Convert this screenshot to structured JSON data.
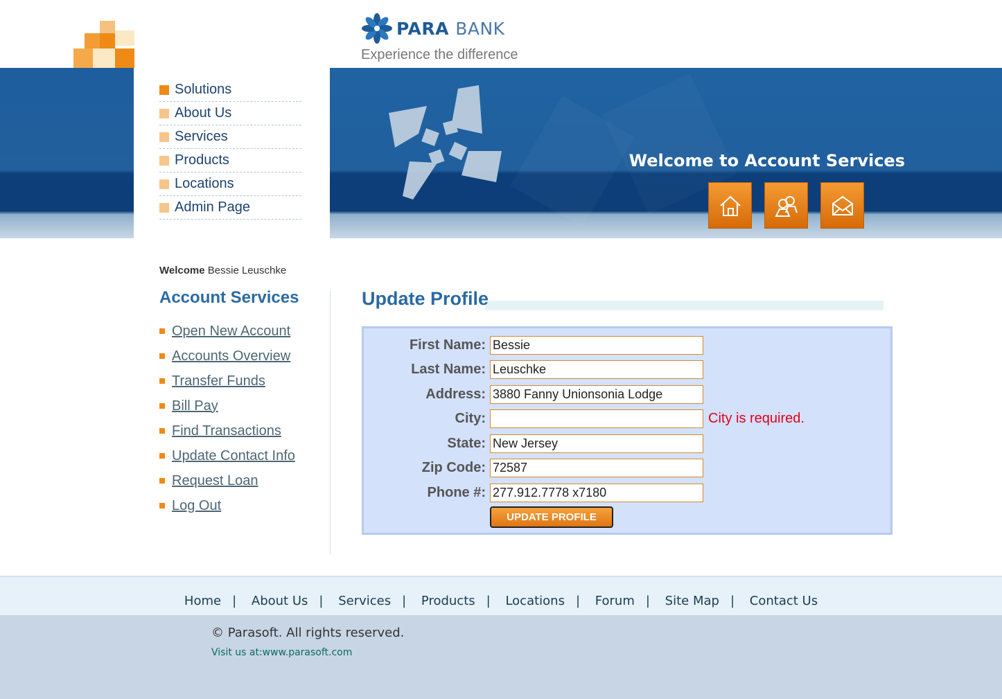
{
  "header": {
    "brand_para": "PARA",
    "brand_bank": "BANK",
    "tagline": "Experience the difference",
    "banner_welcome": "Welcome to Account Services",
    "banner_icons": [
      "home-icon",
      "contacts-icon",
      "envelope-icon"
    ]
  },
  "top_nav": {
    "items": [
      "Solutions",
      "About Us",
      "Services",
      "Products",
      "Locations",
      "Admin Page"
    ]
  },
  "user": {
    "welcome_label": "Welcome",
    "name": "Bessie Leuschke"
  },
  "account_services": {
    "heading": "Account Services",
    "links": [
      "Open New Account",
      "Accounts Overview",
      "Transfer Funds",
      "Bill Pay",
      "Find Transactions",
      "Update Contact Info",
      "Request Loan",
      "Log Out"
    ]
  },
  "form": {
    "title": "Update Profile",
    "first_name_label": "First Name:",
    "first_name": "Bessie",
    "last_name_label": "Last Name:",
    "last_name": "Leuschke",
    "address_label": "Address:",
    "address": "3880 Fanny Unionsonia Lodge",
    "city_label": "City:",
    "city": "",
    "city_error": "City is required.",
    "state_label": "State:",
    "state": "New Jersey",
    "zip_label": "Zip Code:",
    "zip": "72587",
    "phone_label": "Phone #:",
    "phone": "277.912.7778 x7180",
    "submit_label": "UPDATE PROFILE"
  },
  "footer": {
    "links": [
      "Home",
      "About Us",
      "Services",
      "Products",
      "Locations",
      "Forum",
      "Site Map",
      "Contact Us"
    ],
    "copyright": "© Parasoft. All rights reserved.",
    "visit": "Visit us at:www.parasoft.com"
  },
  "colors": {
    "accent_orange": "#ef8a16",
    "brand_blue": "#1f5b96",
    "error_red": "#e0001a",
    "form_bg": "#d3e1fb"
  }
}
